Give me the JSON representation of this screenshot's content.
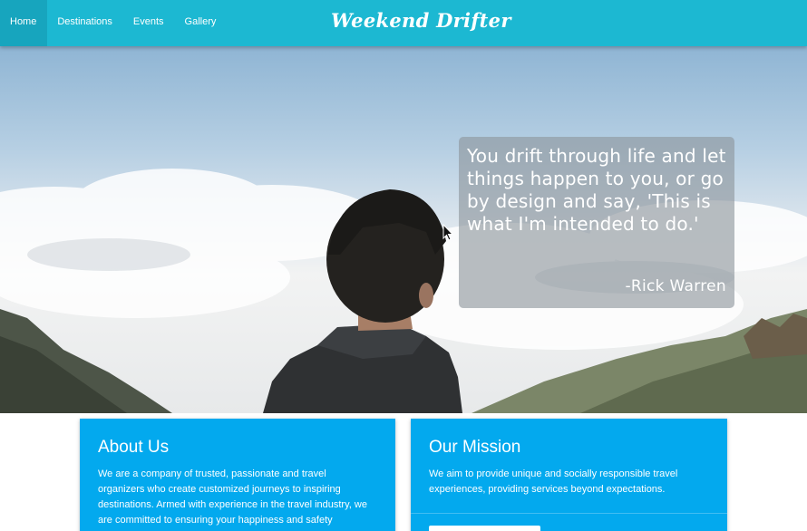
{
  "nav": {
    "items": [
      {
        "label": "Home",
        "active": true
      },
      {
        "label": "Destinations",
        "active": false
      },
      {
        "label": "Events",
        "active": false
      },
      {
        "label": "Gallery",
        "active": false
      }
    ],
    "brand": "Weekend Drifter"
  },
  "hero": {
    "quote": "You drift through life and let things happen to you, or go by design and say, 'This is what I'm intended to do.'",
    "author": "-Rick Warren"
  },
  "cards": {
    "about": {
      "title": "About Us",
      "text": "We are a company of trusted, passionate and travel organizers who create customized journeys to inspiring destinations. Armed with experience in the travel industry, we are committed to ensuring your happiness and safety"
    },
    "mission": {
      "title": "Our Mission",
      "text": "We aim to provide unique and socially responsible travel experiences, providing services beyond expectations."
    }
  },
  "colors": {
    "navbar": "#1cb8d2",
    "nav_active": "#17a5be",
    "card": "#03a9ee"
  }
}
